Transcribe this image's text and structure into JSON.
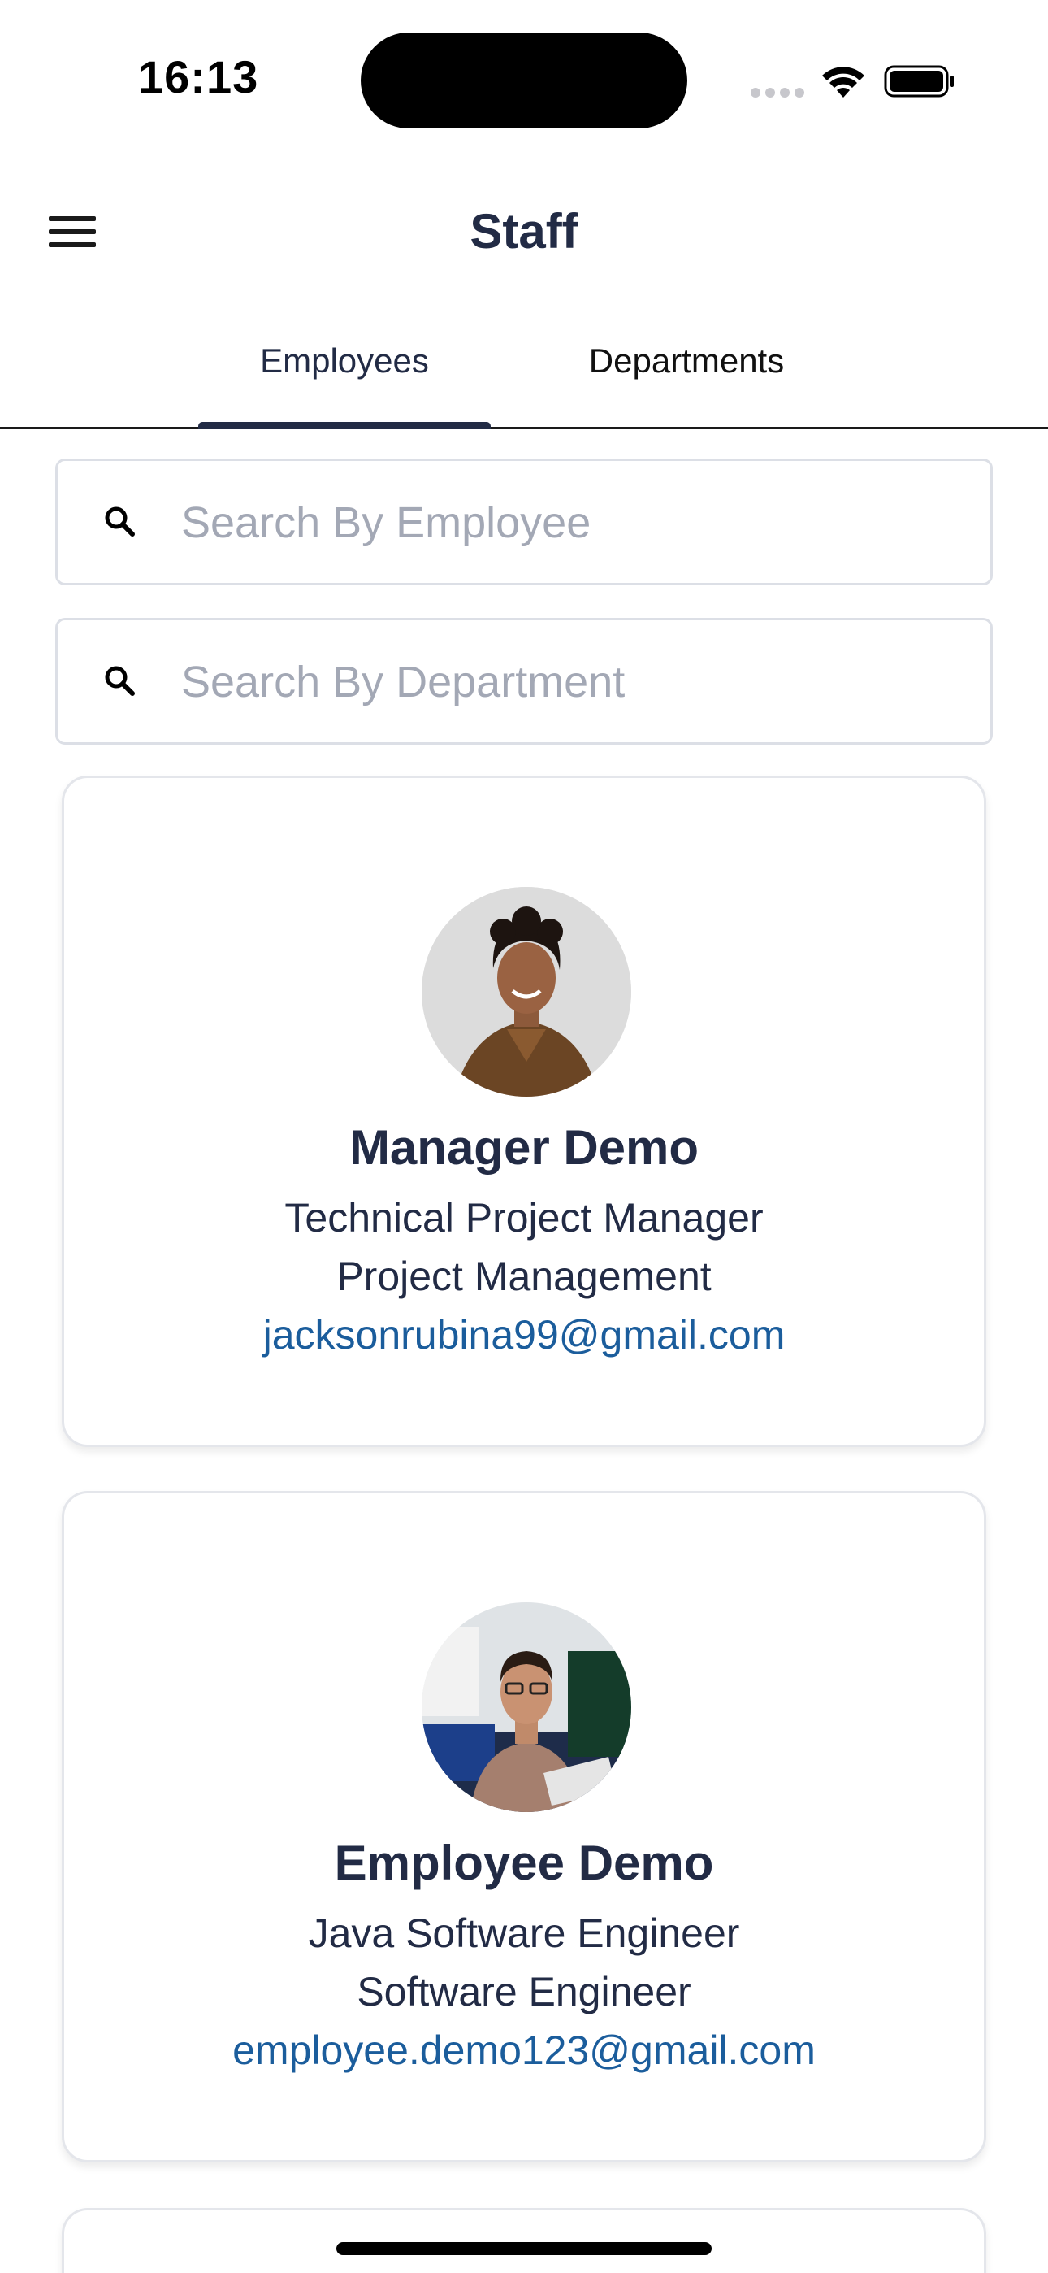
{
  "status_bar": {
    "time": "16:13"
  },
  "header": {
    "title": "Staff",
    "menu_icon": "hamburger-menu-icon"
  },
  "tabs": [
    {
      "label": "Employees",
      "active": true
    },
    {
      "label": "Departments",
      "active": false
    }
  ],
  "search": {
    "employee_placeholder": "Search By Employee",
    "employee_value": "",
    "department_placeholder": "Search By Department",
    "department_value": "",
    "icon": "search-icon"
  },
  "employees": [
    {
      "name": "Manager Demo",
      "title": "Technical Project Manager",
      "department": "Project Management",
      "email": "jacksonrubina99@gmail.com"
    },
    {
      "name": "Employee Demo",
      "title": "Java Software Engineer",
      "department": "Software Engineer",
      "email": "employee.demo123@gmail.com"
    }
  ],
  "colors": {
    "primary_text": "#222b45",
    "link": "#1b5d9c",
    "border": "#dcdfe6",
    "placeholder": "#a3a8b5"
  }
}
